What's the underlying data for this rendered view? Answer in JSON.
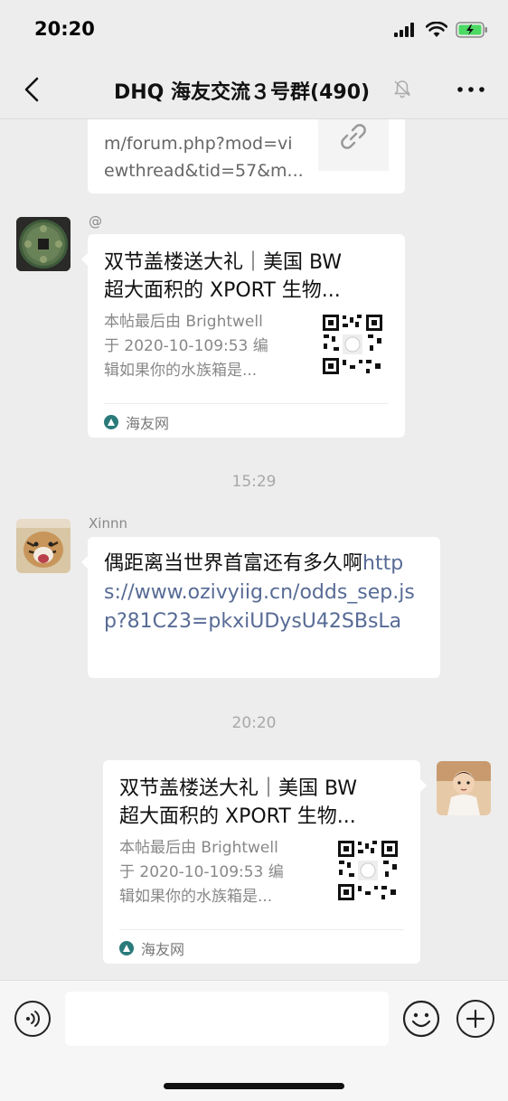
{
  "status_bar": {
    "time": "20:20"
  },
  "nav": {
    "title": "DHQ 海友交流３号群(490)"
  },
  "messages": {
    "first_card": {
      "partial_url_top": "m/forum.php?mod=vi",
      "partial_url_bottom": "ewthread&tid=57&m..."
    },
    "card1": {
      "sender": "@",
      "title_line1": "双节盖楼送大礼｜美国 BW",
      "title_line2": "超大面积的 XPORT 生物...",
      "desc_line1": "本帖最后由 Brightwell",
      "desc_line2": "于 2020-10-109:53 编",
      "desc_line3": "辑如果你的水族箱是...",
      "source": "海友网"
    },
    "time1": "15:29",
    "text_msg": {
      "sender": "Xinnn",
      "text": "偶距离当世界首富还有多久啊",
      "url": "https://www.ozivyiig.cn/odds_sep.jsp?81C23=pkxiUDysU42SBsLa"
    },
    "time2": "20:20",
    "card2": {
      "title_line1": "双节盖楼送大礼｜美国 BW",
      "title_line2": "超大面积的 XPORT 生物...",
      "desc_line1": "本帖最后由 Brightwell",
      "desc_line2": "于 2020-10-109:53 编",
      "desc_line3": "辑如果你的水族箱是...",
      "source": "海友网"
    }
  },
  "input": {
    "value": ""
  },
  "icons": {
    "back": "back-arrow-icon",
    "mute": "mute-bell-icon",
    "more": "more-dots-icon",
    "link": "link-icon",
    "voice": "voice-icon",
    "emoji": "emoji-icon",
    "plus": "plus-icon"
  },
  "colors": {
    "background": "#ededed",
    "bubble": "#ffffff",
    "link_text": "#576b95",
    "secondary_text": "#888888"
  }
}
